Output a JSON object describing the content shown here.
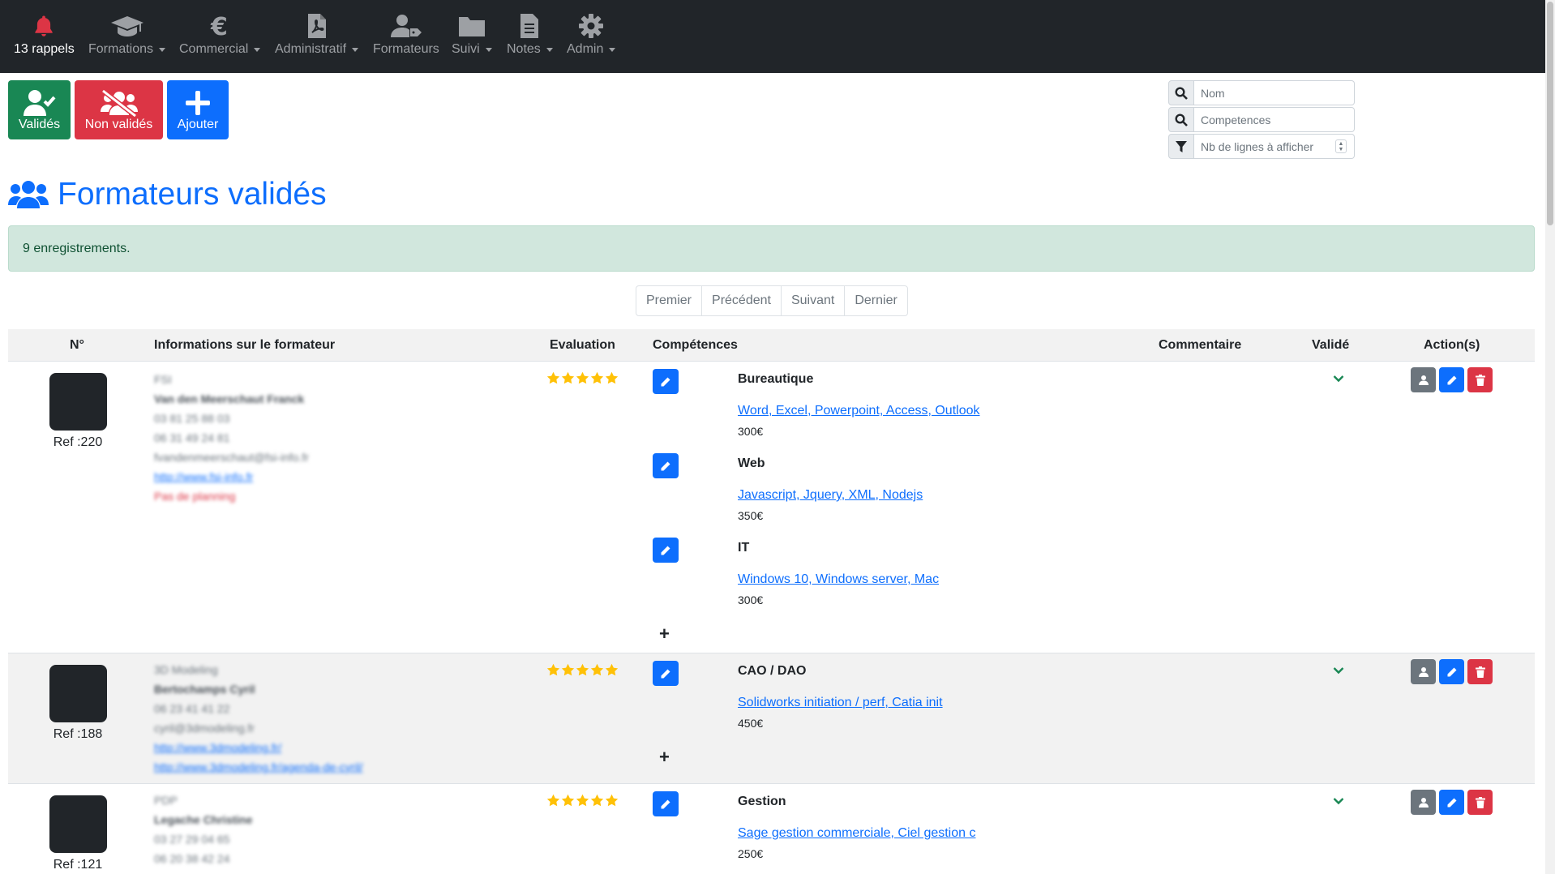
{
  "nav": {
    "items": [
      {
        "label": "13 rappels",
        "icon": "bell-icon",
        "dropdown": false,
        "active": true
      },
      {
        "label": "Formations",
        "icon": "graduation-cap-icon",
        "dropdown": true
      },
      {
        "label": "Commercial",
        "icon": "euro-icon",
        "dropdown": true
      },
      {
        "label": "Administratif",
        "icon": "file-pdf-icon",
        "dropdown": true
      },
      {
        "label": "Formateurs",
        "icon": "user-tag-icon",
        "dropdown": false
      },
      {
        "label": "Suivi",
        "icon": "folder-icon",
        "dropdown": true
      },
      {
        "label": "Notes",
        "icon": "file-text-icon",
        "dropdown": true
      },
      {
        "label": "Admin",
        "icon": "gear-icon",
        "dropdown": true
      }
    ]
  },
  "actions": {
    "valides_label": "Validés",
    "non_valides_label": "Non validés",
    "ajouter_label": "Ajouter"
  },
  "search": {
    "nom_placeholder": "Nom",
    "competences_placeholder": "Competences",
    "lignes_placeholder": "Nb de lignes à afficher"
  },
  "page": {
    "title": "Formateurs validés",
    "alert": "9 enregistrements."
  },
  "pagination": [
    "Premier",
    "Précédent",
    "Suivant",
    "Dernier"
  ],
  "table": {
    "headers": {
      "num": "N°",
      "info": "Informations sur le formateur",
      "evaluation": "Evaluation",
      "competences": "Compétences",
      "commentaire": "Commentaire",
      "valide": "Validé",
      "actions": "Action(s)"
    },
    "rows": [
      {
        "ref": "Ref :220",
        "stars": 5,
        "info_blurred": [
          "FSI",
          "Van den Meerschaut Franck",
          "03 81 25 88 03",
          "06 31 49 24 81",
          "fvandenmeerschaut@fsi-info.fr",
          "http://www.fsi-info.fr",
          "Pas de planning"
        ],
        "competences": [
          {
            "title": "Bureautique",
            "link": "Word, Excel, Powerpoint, Access, Outlook",
            "price": "300€"
          },
          {
            "title": "Web",
            "link": "Javascript, Jquery, XML, Nodejs",
            "price": "350€"
          },
          {
            "title": "IT",
            "link": "Windows 10, Windows server, Mac",
            "price": "300€"
          }
        ]
      },
      {
        "ref": "Ref :188",
        "stars": 5,
        "info_blurred": [
          "3D Modeling",
          "Bertochamps Cyril",
          "06 23 41 41 22",
          "cyril@3dmodeling.fr",
          "http://www.3dmodeling.fr/",
          "http://www.3dmodeling.fr/agenda-de-cyril/"
        ],
        "competences": [
          {
            "title": "CAO / DAO",
            "link": "Solidworks initiation / perf, Catia init",
            "price": "450€"
          }
        ]
      },
      {
        "ref": "Ref :121",
        "stars": 5,
        "info_blurred": [
          "PDP",
          "Legache Christine",
          "03 27 29 04 65",
          "06 20 38 42 24"
        ],
        "competences": [
          {
            "title": "Gestion",
            "link": "Sage gestion commerciale, Ciel gestion c",
            "price": "250€"
          }
        ]
      }
    ],
    "add_symbol": "+"
  },
  "colors": {
    "navbar": "#212529",
    "primary": "#0d6efd",
    "success": "#198754",
    "danger": "#dc3545",
    "star": "#ffc107"
  }
}
